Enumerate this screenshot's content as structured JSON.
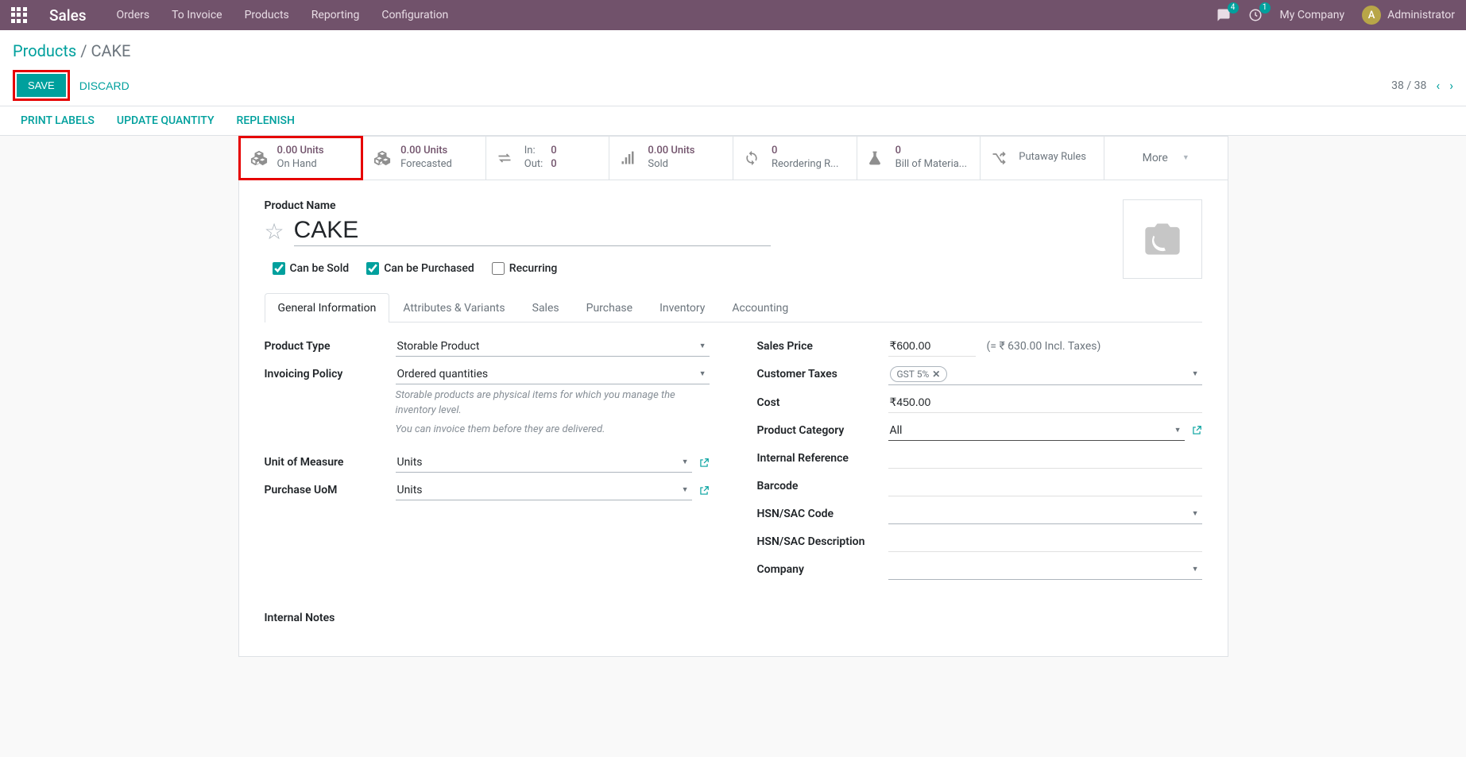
{
  "topnav": {
    "app_title": "Sales",
    "links": [
      "Orders",
      "To Invoice",
      "Products",
      "Reporting",
      "Configuration"
    ],
    "chat_badge": "4",
    "activity_badge": "1",
    "company": "My Company",
    "user_initial": "A",
    "user_name": "Administrator"
  },
  "breadcrumb": {
    "root": "Products",
    "current": "CAKE"
  },
  "actions": {
    "save": "SAVE",
    "discard": "DISCARD",
    "pager": "38 / 38"
  },
  "toolbar2": [
    "PRINT LABELS",
    "UPDATE QUANTITY",
    "REPLENISH"
  ],
  "stats": {
    "onhand_val": "0.00 Units",
    "onhand_lbl": "On Hand",
    "forecast_val": "0.00 Units",
    "forecast_lbl": "Forecasted",
    "in_lbl": "In:",
    "in_val": "0",
    "out_lbl": "Out:",
    "out_val": "0",
    "sold_val": "0.00 Units",
    "sold_lbl": "Sold",
    "reorder_val": "0",
    "reorder_lbl": "Reordering R...",
    "bom_val": "0",
    "bom_lbl": "Bill of Materia...",
    "putaway_lbl": "Putaway Rules",
    "more_lbl": "More"
  },
  "product": {
    "name_label": "Product Name",
    "name": "CAKE",
    "can_be_sold": "Can be Sold",
    "can_be_purchased": "Can be Purchased",
    "recurring": "Recurring"
  },
  "tabs": [
    "General Information",
    "Attributes & Variants",
    "Sales",
    "Purchase",
    "Inventory",
    "Accounting"
  ],
  "fields_left": {
    "product_type_lbl": "Product Type",
    "product_type_val": "Storable Product",
    "invoicing_policy_lbl": "Invoicing Policy",
    "invoicing_policy_val": "Ordered quantities",
    "help1": "Storable products are physical items for which you manage the inventory level.",
    "help2": "You can invoice them before they are delivered.",
    "uom_lbl": "Unit of Measure",
    "uom_val": "Units",
    "purchase_uom_lbl": "Purchase UoM",
    "purchase_uom_val": "Units"
  },
  "fields_right": {
    "sales_price_lbl": "Sales Price",
    "sales_price_val": "₹600.00",
    "sales_price_incl": "(= ₹ 630.00 Incl. Taxes)",
    "customer_taxes_lbl": "Customer Taxes",
    "customer_taxes_val": "GST 5%",
    "cost_lbl": "Cost",
    "cost_val": "₹450.00",
    "category_lbl": "Product Category",
    "category_val": "All",
    "internal_ref_lbl": "Internal Reference",
    "barcode_lbl": "Barcode",
    "hsn_code_lbl": "HSN/SAC Code",
    "hsn_desc_lbl": "HSN/SAC Description",
    "company_lbl": "Company"
  },
  "notes_lbl": "Internal Notes"
}
